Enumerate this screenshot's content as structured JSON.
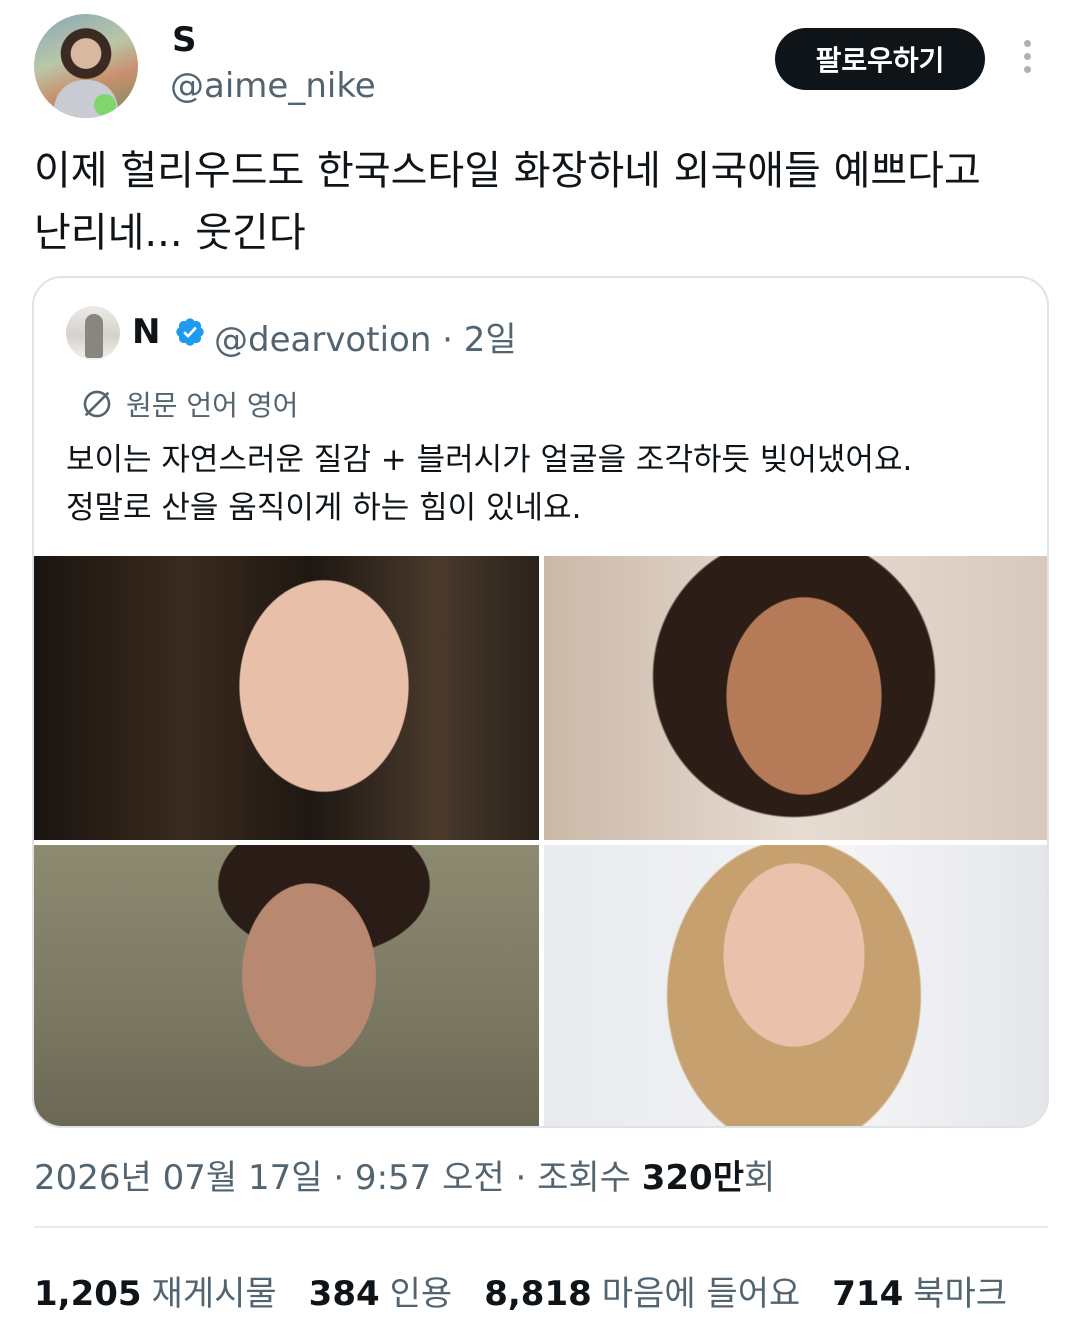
{
  "author": {
    "display_name": "S",
    "handle": "@aime_nike",
    "follow_label": "팔로우하기"
  },
  "tweet": {
    "text_line1": "이제 헐리우드도 한국스타일 화장하네 외국애들 예쁘다고",
    "text_line2": "난리네... 웃긴다"
  },
  "quote": {
    "name": "N",
    "handle_time": "@dearvotion · 2일",
    "translate_label": "원문 언어 영어",
    "text_line1": "보이는 자연스러운 질감 + 블러시가 얼굴을 조각하듯 빚어냈어요.",
    "text_line2": "정말로 산을 움직이게 하는 힘이 있네요.",
    "verified_color": "#1d9bf0"
  },
  "meta": {
    "datetime_views_prefix": "2026년 07월 17일 · 9:57 오전 · 조회수 ",
    "views_count": "320만",
    "views_suffix": "회"
  },
  "stats": [
    {
      "num": "1,205",
      "label": "재게시물"
    },
    {
      "num": "384",
      "label": "인용"
    },
    {
      "num": "8,818",
      "label": "마음에 들어요"
    },
    {
      "num": "714",
      "label": "북마크"
    }
  ],
  "colors": {
    "text_primary": "#0f1419",
    "text_secondary": "#536471",
    "follow_button_bg": "#0f1419",
    "border": "#dde3e7"
  }
}
